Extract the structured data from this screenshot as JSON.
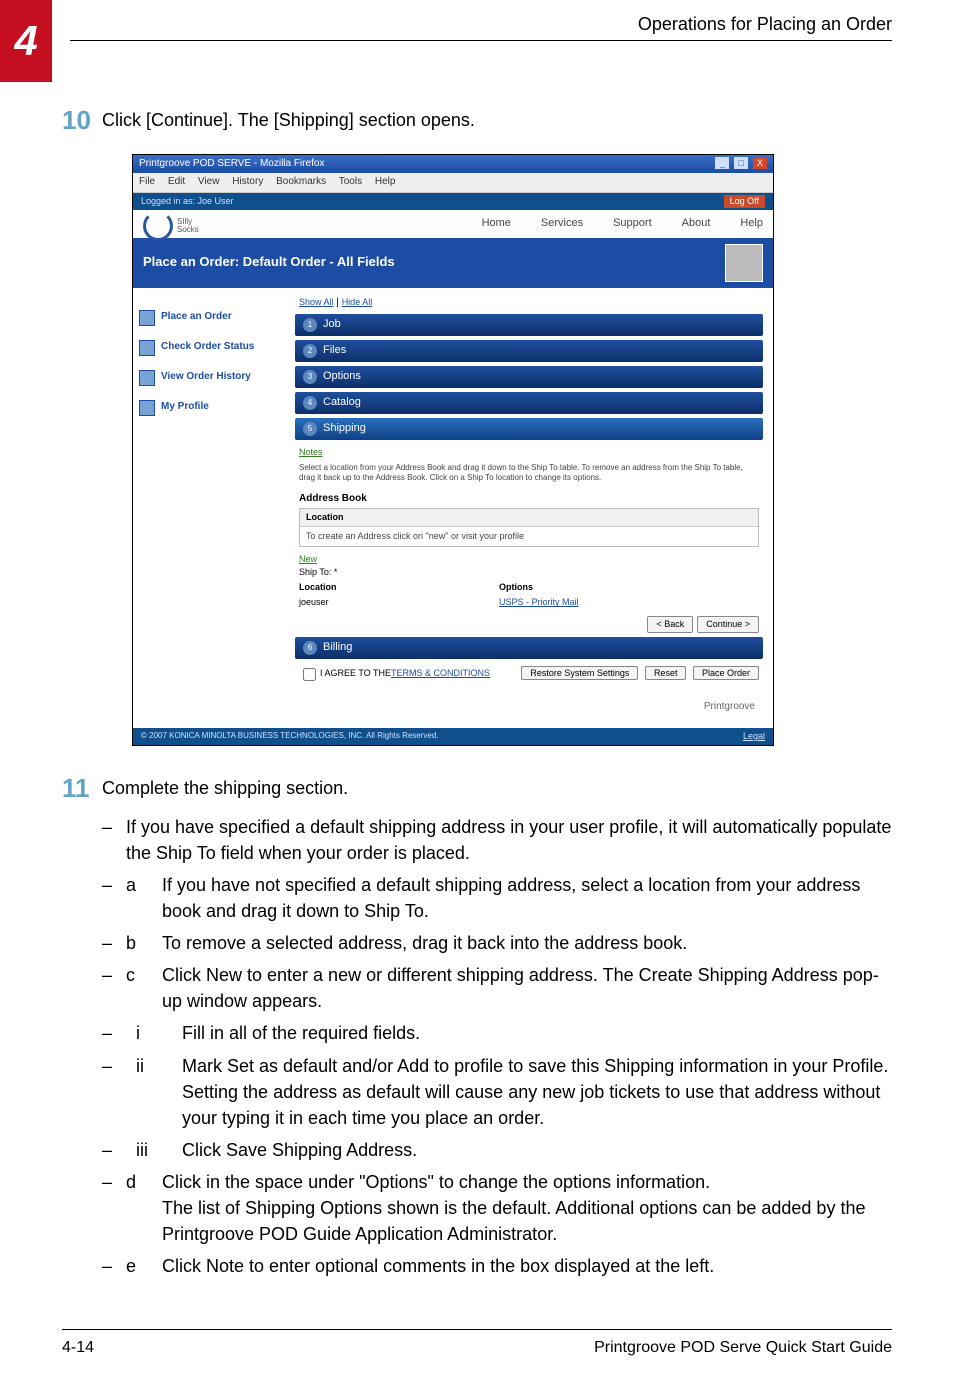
{
  "header": {
    "chapter": "4",
    "section_title": "Operations for Placing an Order"
  },
  "steps": {
    "s10": {
      "num": "10",
      "text": "Click [Continue]. The [Shipping] section opens."
    },
    "s11": {
      "num": "11",
      "text": "Complete the shipping section."
    }
  },
  "bullets": {
    "b1": "If you have specified a default shipping address in your user profile, it will automatically populate the Ship To field when your order is placed.",
    "b2_text": "If you have not specified a default shipping address, select a location from your address book and drag it down to Ship To.",
    "b3_text": "To remove a selected address, drag it back into the address book.",
    "b4_text": "Click New to enter a new or different shipping address. The Create Shipping Address pop-up window appears.",
    "b4_i": "Fill in all of the required fields.",
    "b4_ii": "Mark Set as default and/or Add to profile to save this Shipping information in your Profile. Setting the address as default will cause any new job tickets to use that address without your typing it in each time you place an order.",
    "b4_iii": "Click Save Shipping Address.",
    "b5_text": "Click in the space under \"Options\" to change the options information.",
    "b5_extra": "The list of Shipping Options shown is the default. Additional options can be added by the Printgroove POD Guide Application Administrator.",
    "b6_text": "Click Note to enter optional comments in the box displayed at the left."
  },
  "markers": {
    "a": "a",
    "b": "b",
    "c": "c",
    "d": "d",
    "e": "e",
    "i": "i",
    "ii": "ii",
    "iii": "iii"
  },
  "footer": {
    "page": "4-14",
    "doc": "Printgroove POD Serve Quick Start Guide"
  },
  "shot": {
    "title": "Printgroove POD SERVE - Mozilla Firefox",
    "menu": {
      "file": "File",
      "edit": "Edit",
      "view": "View",
      "history": "History",
      "bookmarks": "Bookmarks",
      "tools": "Tools",
      "help": "Help"
    },
    "logbar": {
      "logged": "Logged in as: Joe User",
      "logoff": "Log Off"
    },
    "nav": {
      "home": "Home",
      "services": "Services",
      "support": "Support",
      "about": "About",
      "help": "Help"
    },
    "pagetitle": "Place an Order: Default Order - All Fields",
    "side": {
      "place": "Place an Order",
      "status": "Check Order Status",
      "history": "View Order History",
      "profile": "My Profile"
    },
    "links": {
      "showall": "Show All",
      "hideall": "Hide All",
      "sep": " | "
    },
    "accord": {
      "job": "Job",
      "files": "Files",
      "options": "Options",
      "catalog": "Catalog",
      "shipping": "Shipping",
      "billing": "Billing",
      "n1": "1",
      "n2": "2",
      "n3": "3",
      "n4": "4",
      "n5": "5",
      "n6": "6"
    },
    "note_link": "Notes",
    "helptext": "Select a location from your Address Book and drag it down to the Ship To table. To remove an address from the Ship To table, drag it back up to the Address Book. Click on a Ship To location to change its options.",
    "addrbook": "Address Book",
    "loc_hdr": "Location",
    "create_addr": "To create an Address click on \"new\" or visit your profile",
    "new_label": "New",
    "shipto": "Ship To: *",
    "opt_hdr": "Options",
    "row_user": "joeuser",
    "row_opt": "USPS - Priority Mail",
    "btn_back": "< Back",
    "btn_cont": "Continue >",
    "terms_pre": "I AGREE TO THE ",
    "terms_link": "TERMS & CONDITIONS",
    "btn_restore": "Restore System Settings",
    "btn_reset": "Reset",
    "btn_place": "Place Order",
    "copyright": "© 2007 KONICA MINOLTA BUSINESS TECHNOLOGIES, INC. All Rights Reserved.",
    "legal": "Legal",
    "pg": "Printgroove",
    "brand_line1": "SIlly",
    "brand_line2": "Socks",
    "win_min": "_",
    "win_max": "□",
    "win_close": "X"
  }
}
